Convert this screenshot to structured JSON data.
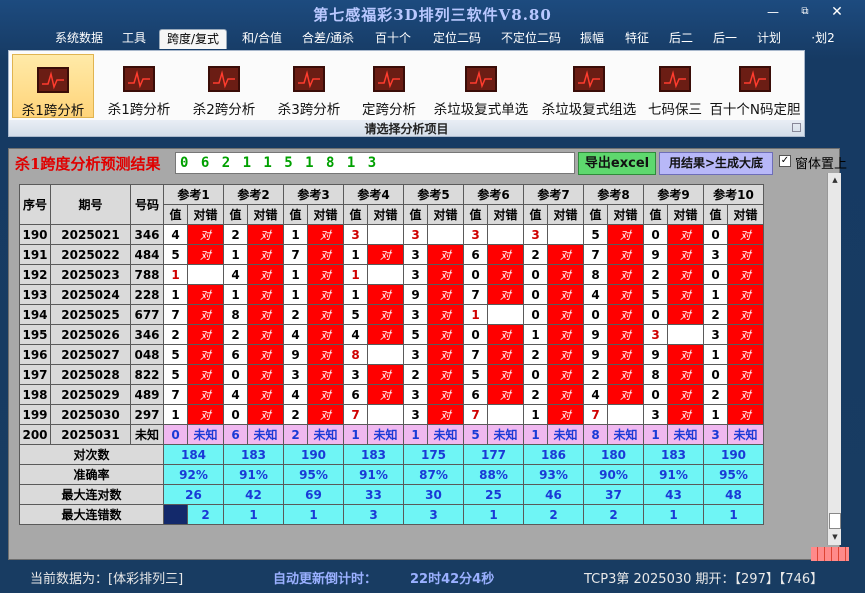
{
  "window": {
    "title": "第七感福彩3D排列三软件V8.80"
  },
  "menu": [
    "系统数据",
    "工具",
    "跨度/复式",
    "和/合值",
    "合差/通杀",
    "百十个",
    "定位二码",
    "不定位二码",
    "振幅",
    "特征",
    "后二",
    "后一",
    "计划",
    "·划2"
  ],
  "ribbon": {
    "buttons": [
      "杀1跨分析",
      "杀1跨分析",
      "杀2跨分析",
      "杀3跨分析",
      "定跨分析",
      "杀垃圾复式单选",
      "杀垃圾复式组选",
      "七码保三",
      "百十个N码定胆"
    ],
    "group_label": "请选择分析项目"
  },
  "result": {
    "title": "杀1跨度分析预测结果",
    "numbers": "0 6 2 1 1 5 1 8 1 3",
    "export_label": "导出excel",
    "generate_label": "用结果>生成大底",
    "checkbox_mark": "✓",
    "checkbox_label": "窗体置上"
  },
  "table": {
    "headers": {
      "seq": "序号",
      "period": "期号",
      "code": "号码",
      "val": "值",
      "hit": "对错"
    },
    "refs": [
      "参考1",
      "参考2",
      "参考3",
      "参考4",
      "参考5",
      "参考6",
      "参考7",
      "参考8",
      "参考9",
      "参考10"
    ],
    "hit_text": "对",
    "rows": [
      {
        "seq": "190",
        "period": "2025021",
        "code": "346",
        "v": [
          "4",
          "2",
          "1",
          "3",
          "3",
          "3",
          "3",
          "5",
          "0",
          "0"
        ],
        "h": [
          1,
          1,
          1,
          0,
          0,
          0,
          0,
          1,
          1,
          1
        ],
        "r": [
          0,
          0,
          0,
          1,
          1,
          1,
          1,
          0,
          0,
          0
        ]
      },
      {
        "seq": "191",
        "period": "2025022",
        "code": "484",
        "v": [
          "5",
          "1",
          "7",
          "1",
          "3",
          "6",
          "2",
          "7",
          "9",
          "3"
        ],
        "h": [
          1,
          1,
          1,
          1,
          1,
          1,
          1,
          1,
          1,
          1
        ],
        "r": [
          0,
          0,
          0,
          0,
          0,
          0,
          0,
          0,
          0,
          0
        ]
      },
      {
        "seq": "192",
        "period": "2025023",
        "code": "788",
        "v": [
          "1",
          "4",
          "1",
          "1",
          "3",
          "0",
          "0",
          "8",
          "2",
          "0"
        ],
        "h": [
          0,
          1,
          1,
          0,
          1,
          1,
          1,
          1,
          1,
          1
        ],
        "r": [
          1,
          0,
          0,
          1,
          0,
          0,
          0,
          0,
          0,
          0
        ]
      },
      {
        "seq": "193",
        "period": "2025024",
        "code": "228",
        "v": [
          "1",
          "1",
          "1",
          "1",
          "9",
          "7",
          "0",
          "4",
          "5",
          "1"
        ],
        "h": [
          1,
          1,
          1,
          1,
          1,
          1,
          1,
          1,
          1,
          1
        ],
        "r": [
          0,
          0,
          0,
          0,
          0,
          0,
          0,
          0,
          0,
          0
        ]
      },
      {
        "seq": "194",
        "period": "2025025",
        "code": "677",
        "v": [
          "7",
          "8",
          "2",
          "5",
          "3",
          "1",
          "0",
          "0",
          "0",
          "2"
        ],
        "h": [
          1,
          1,
          1,
          1,
          1,
          0,
          1,
          1,
          1,
          1
        ],
        "r": [
          0,
          0,
          0,
          0,
          0,
          1,
          0,
          0,
          0,
          0
        ]
      },
      {
        "seq": "195",
        "period": "2025026",
        "code": "346",
        "v": [
          "2",
          "2",
          "4",
          "4",
          "5",
          "0",
          "1",
          "9",
          "3",
          "3"
        ],
        "h": [
          1,
          1,
          1,
          1,
          1,
          1,
          1,
          1,
          0,
          1
        ],
        "r": [
          0,
          0,
          0,
          0,
          0,
          0,
          0,
          0,
          1,
          0
        ]
      },
      {
        "seq": "196",
        "period": "2025027",
        "code": "048",
        "v": [
          "5",
          "6",
          "9",
          "8",
          "3",
          "7",
          "2",
          "9",
          "9",
          "1"
        ],
        "h": [
          1,
          1,
          1,
          0,
          1,
          1,
          1,
          1,
          1,
          1
        ],
        "r": [
          0,
          0,
          0,
          1,
          0,
          0,
          0,
          0,
          0,
          0
        ]
      },
      {
        "seq": "197",
        "period": "2025028",
        "code": "822",
        "v": [
          "5",
          "0",
          "3",
          "3",
          "2",
          "5",
          "0",
          "2",
          "8",
          "0"
        ],
        "h": [
          1,
          1,
          1,
          1,
          1,
          1,
          1,
          1,
          1,
          1
        ],
        "r": [
          0,
          0,
          0,
          0,
          0,
          0,
          0,
          0,
          0,
          0
        ]
      },
      {
        "seq": "198",
        "period": "2025029",
        "code": "489",
        "v": [
          "7",
          "4",
          "4",
          "6",
          "3",
          "6",
          "2",
          "4",
          "0",
          "2"
        ],
        "h": [
          1,
          1,
          1,
          1,
          1,
          1,
          1,
          1,
          1,
          1
        ],
        "r": [
          0,
          0,
          0,
          0,
          0,
          0,
          0,
          0,
          0,
          0
        ]
      },
      {
        "seq": "199",
        "period": "2025030",
        "code": "297",
        "v": [
          "1",
          "0",
          "2",
          "7",
          "3",
          "7",
          "1",
          "7",
          "3",
          "1"
        ],
        "h": [
          1,
          1,
          1,
          0,
          1,
          0,
          1,
          0,
          1,
          1
        ],
        "r": [
          0,
          0,
          0,
          1,
          0,
          1,
          0,
          1,
          0,
          0
        ]
      }
    ],
    "pending": {
      "seq": "200",
      "period": "2025031",
      "code": "未知",
      "v": [
        "0",
        "6",
        "2",
        "1",
        "1",
        "5",
        "1",
        "8",
        "1",
        "3"
      ],
      "label": "未知"
    },
    "stats": [
      {
        "label": "对次数",
        "values": [
          "184",
          "183",
          "190",
          "183",
          "175",
          "177",
          "186",
          "180",
          "183",
          "190"
        ]
      },
      {
        "label": "准确率",
        "values": [
          "92%",
          "91%",
          "95%",
          "91%",
          "87%",
          "88%",
          "93%",
          "90%",
          "91%",
          "95%"
        ]
      },
      {
        "label": "最大连对数",
        "values": [
          "26",
          "42",
          "69",
          "33",
          "30",
          "25",
          "46",
          "37",
          "43",
          "48"
        ]
      },
      {
        "label": "最大连错数",
        "values": [
          "2",
          "1",
          "1",
          "3",
          "3",
          "1",
          "2",
          "2",
          "1",
          "1"
        ]
      }
    ]
  },
  "status": {
    "current_data": "当前数据为：[体彩排列三]",
    "countdown_label": "自动更新倒计时：",
    "countdown_value": "22时42分4秒",
    "latest_draw": "TCP3第 2025030 期开：【297】【746】"
  }
}
